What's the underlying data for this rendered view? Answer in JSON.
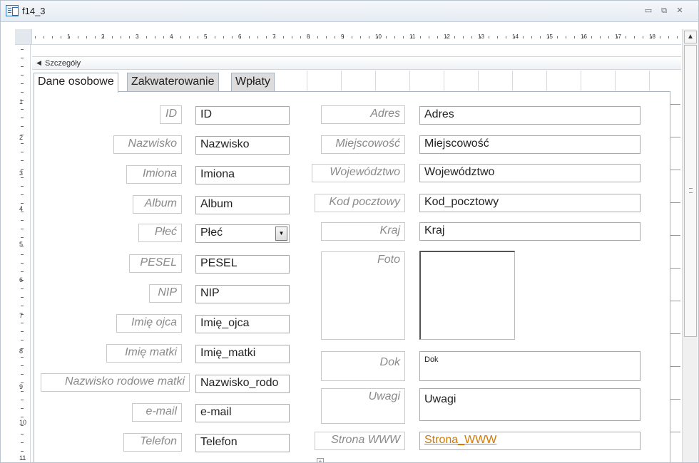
{
  "window": {
    "title": "f14_3",
    "icon": "form-icon",
    "controls": {
      "minimize": "▭",
      "restore": "⧉",
      "close": "✕"
    }
  },
  "ruler": {
    "horizontal_numbers": [
      "1",
      "2",
      "3",
      "4",
      "5",
      "6",
      "7",
      "8",
      "9",
      "10",
      "11",
      "12",
      "13",
      "14",
      "15",
      "16",
      "17",
      "18"
    ],
    "vertical_numbers": [
      "1",
      "2",
      "3",
      "4",
      "5",
      "6",
      "7",
      "8",
      "9",
      "10",
      "11"
    ]
  },
  "section": {
    "label": "Szczegóły",
    "icon": "section-collapse-icon"
  },
  "tabs": [
    {
      "label": "Dane osobowe",
      "active": true
    },
    {
      "label": "Zakwaterowanie",
      "active": false
    },
    {
      "label": "Wpłaty",
      "active": false
    }
  ],
  "left_fields": [
    {
      "label": "ID",
      "value": "ID"
    },
    {
      "label": "Nazwisko",
      "value": "Nazwisko"
    },
    {
      "label": "Imiona",
      "value": "Imiona"
    },
    {
      "label": "Album",
      "value": "Album"
    },
    {
      "label": "Płeć",
      "value": "Płeć",
      "combo": true
    },
    {
      "label": "PESEL",
      "value": "PESEL"
    },
    {
      "label": "NIP",
      "value": "NIP"
    },
    {
      "label": "Imię ojca",
      "value": "Imię_ojca"
    },
    {
      "label": "Imię matki",
      "value": "Imię_matki"
    },
    {
      "label": "Nazwisko rodowe matki",
      "value": "Nazwisko_rodo"
    },
    {
      "label": "e-mail",
      "value": "e-mail"
    },
    {
      "label": "Telefon",
      "value": "Telefon"
    }
  ],
  "right_fields": [
    {
      "label": "Adres",
      "value": "Adres"
    },
    {
      "label": "Miejscowość",
      "value": "Miejscowość"
    },
    {
      "label": "Województwo",
      "value": "Województwo"
    },
    {
      "label": "Kod pocztowy",
      "value": "Kod_pocztowy"
    },
    {
      "label": "Kraj",
      "value": "Kraj"
    },
    {
      "label": "Foto",
      "value": ""
    },
    {
      "label": "Dok",
      "value": "Dok"
    },
    {
      "label": "Uwagi",
      "value": "Uwagi"
    },
    {
      "label": "Strona WWW",
      "value": "Strona_WWW"
    }
  ],
  "colors": {
    "link": "#d37800",
    "label_text": "#8a8a8a",
    "tab_inactive": "#dcdcdc"
  }
}
